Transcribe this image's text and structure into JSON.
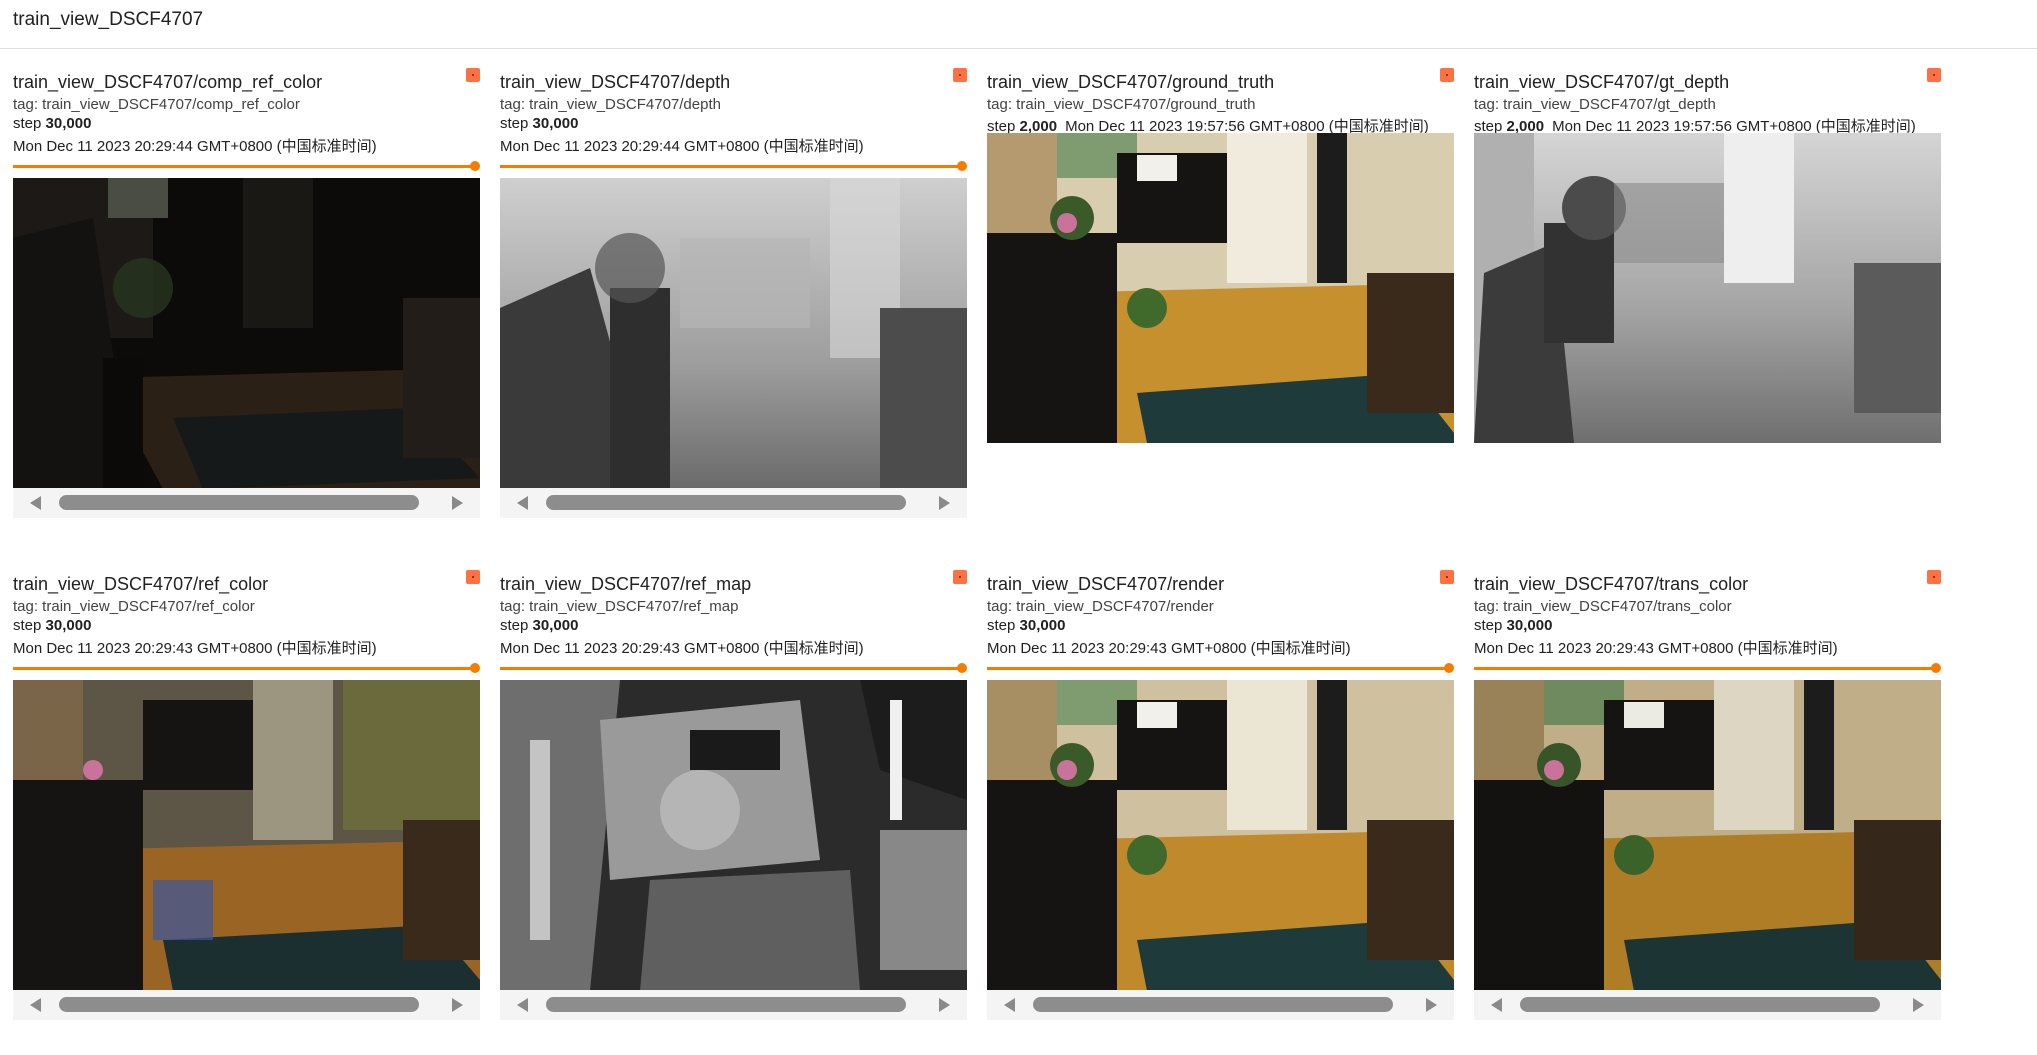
{
  "group": {
    "title": "train_view_DSCF4707"
  },
  "cards": [
    {
      "title": "train_view_DSCF4707/comp_ref_color",
      "tag": "tag: train_view_DSCF4707/comp_ref_color",
      "step_label": "step",
      "step": "30,000",
      "timestamp": "Mon Dec 11 2023 20:29:44 GMT+0800 (中国标准时间)"
    },
    {
      "title": "train_view_DSCF4707/depth",
      "tag": "tag: train_view_DSCF4707/depth",
      "step_label": "step",
      "step": "30,000",
      "timestamp": "Mon Dec 11 2023 20:29:44 GMT+0800 (中国标准时间)"
    },
    {
      "title": "train_view_DSCF4707/ground_truth",
      "tag": "tag: train_view_DSCF4707/ground_truth",
      "step_label": "step",
      "step": "2,000",
      "timestamp": "Mon Dec 11 2023 19:57:56 GMT+0800 (中国标准时间)"
    },
    {
      "title": "train_view_DSCF4707/gt_depth",
      "tag": "tag: train_view_DSCF4707/gt_depth",
      "step_label": "step",
      "step": "2,000",
      "timestamp": "Mon Dec 11 2023 19:57:56 GMT+0800 (中国标准时间)"
    },
    {
      "title": "train_view_DSCF4707/ref_color",
      "tag": "tag: train_view_DSCF4707/ref_color",
      "step_label": "step",
      "step": "30,000",
      "timestamp": "Mon Dec 11 2023 20:29:43 GMT+0800 (中国标准时间)"
    },
    {
      "title": "train_view_DSCF4707/ref_map",
      "tag": "tag: train_view_DSCF4707/ref_map",
      "step_label": "step",
      "step": "30,000",
      "timestamp": "Mon Dec 11 2023 20:29:43 GMT+0800 (中国标准时间)"
    },
    {
      "title": "train_view_DSCF4707/render",
      "tag": "tag: train_view_DSCF4707/render",
      "step_label": "step",
      "step": "30,000",
      "timestamp": "Mon Dec 11 2023 20:29:43 GMT+0800 (中国标准时间)"
    },
    {
      "title": "train_view_DSCF4707/trans_color",
      "tag": "tag: train_view_DSCF4707/trans_color",
      "step_label": "step",
      "step": "30,000",
      "timestamp": "Mon Dec 11 2023 20:29:43 GMT+0800 (中国标准时间)"
    }
  ],
  "colors": {
    "accent": "#f57c00",
    "pin": "#ff7043"
  }
}
